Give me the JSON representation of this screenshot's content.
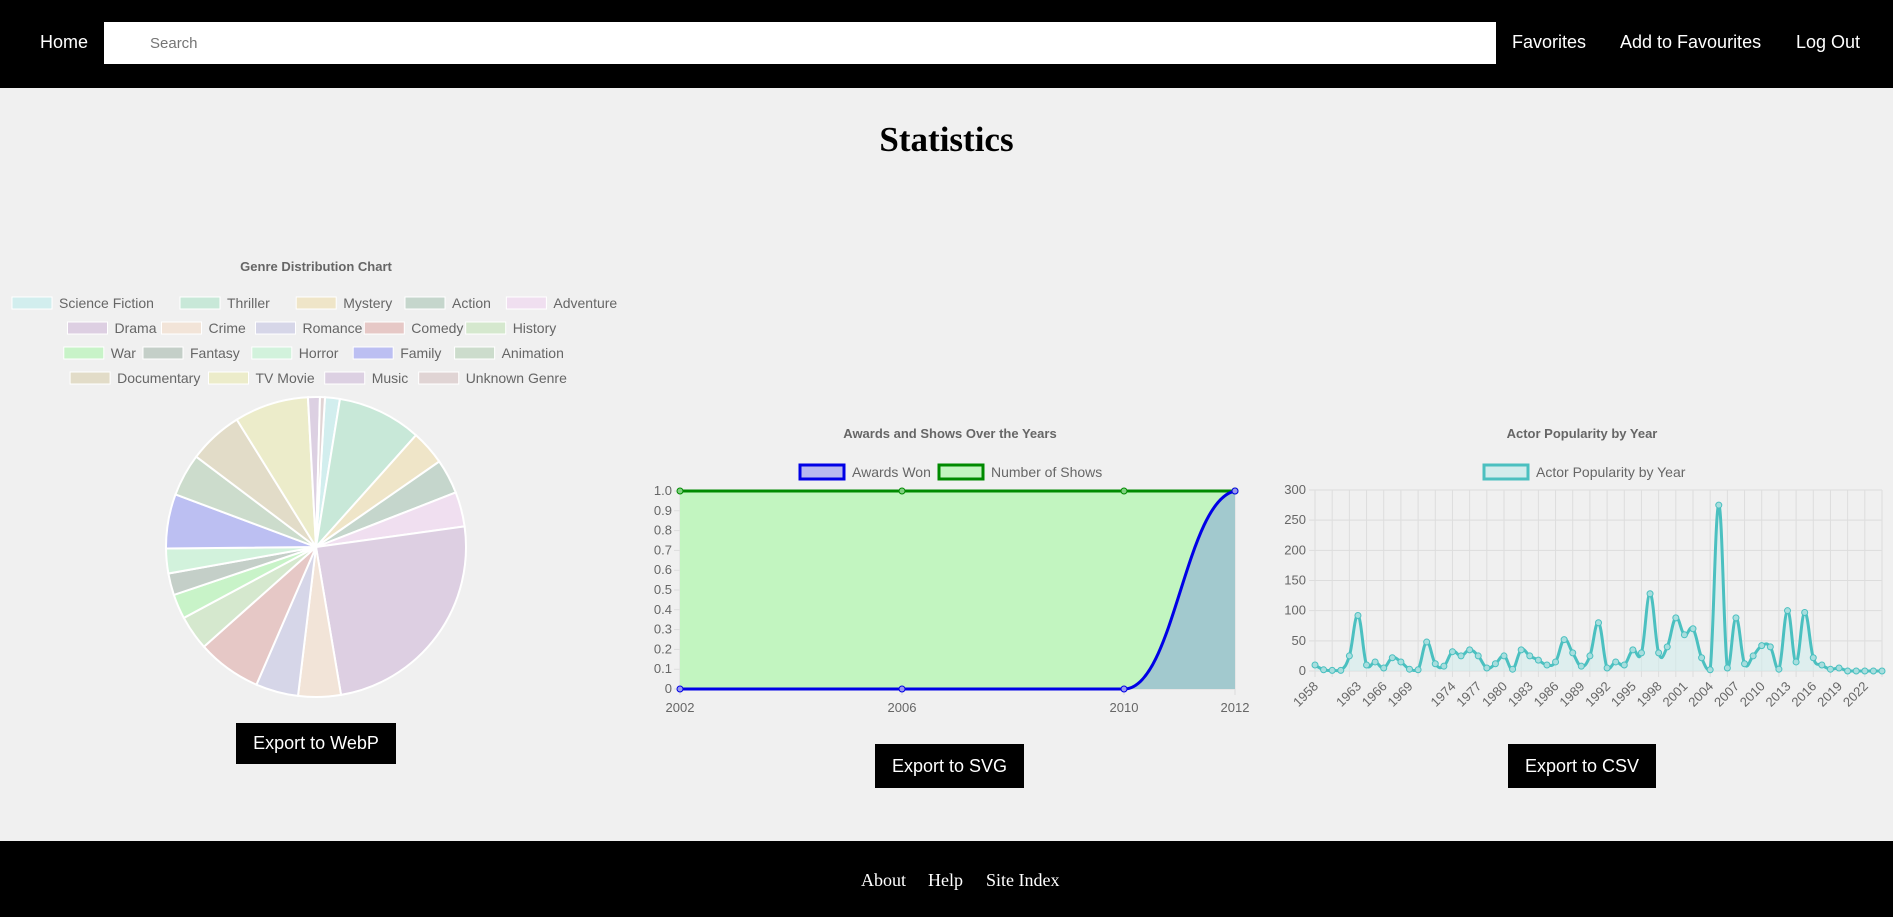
{
  "header": {
    "home_label": "Home",
    "search_placeholder": "Search",
    "search_value": "",
    "nav": [
      "Favorites",
      "Add to Favourites",
      "Log Out"
    ]
  },
  "page_title": "Statistics",
  "buttons": {
    "export_webp": "Export to WebP",
    "export_svg": "Export to SVG",
    "export_csv": "Export to CSV"
  },
  "footer": {
    "links": [
      "About",
      "Help",
      "Site Index"
    ]
  },
  "chart_data": [
    {
      "type": "pie",
      "title": "Genre Distribution Chart",
      "legend_position": "top",
      "categories": [
        "Science Fiction",
        "Thriller",
        "Mystery",
        "Action",
        "Adventure",
        "Drama",
        "Crime",
        "Romance",
        "Comedy",
        "History",
        "War",
        "Fantasy",
        "Horror",
        "Family",
        "Animation",
        "Documentary",
        "TV Movie",
        "Music",
        "Unknown Genre"
      ],
      "values": [
        1.5,
        8.5,
        3.5,
        3.5,
        3.5,
        23,
        4.3,
        4.3,
        6.5,
        3.5,
        2.5,
        2.2,
        2.5,
        5.5,
        4.3,
        5.5,
        7.5,
        1.2,
        0.5
      ],
      "colors": [
        "#d2eeee",
        "#c8e8d8",
        "#efe5c8",
        "#c5d6cc",
        "#f0dff0",
        "#ddcfe2",
        "#f2e4d8",
        "#d6d6e8",
        "#e6c8c6",
        "#d5e8ce",
        "#c8f3c8",
        "#c4cfc8",
        "#d2f2dc",
        "#bcbff2",
        "#ccdccc",
        "#e2dcc8",
        "#ececca",
        "#dcd0e2",
        "#e0d4d4"
      ]
    },
    {
      "type": "line",
      "title": "Awards and Shows Over the Years",
      "legend_position": "top",
      "x": [
        2002,
        2006,
        2010,
        2012
      ],
      "ylim": [
        0,
        1
      ],
      "yticks": [
        "0",
        "0.1",
        "0.2",
        "0.3",
        "0.4",
        "0.5",
        "0.6",
        "0.7",
        "0.8",
        "0.9",
        "1.0"
      ],
      "series": [
        {
          "name": "Awards Won",
          "values": [
            0,
            0,
            0,
            1
          ],
          "color": "#0000e6",
          "fill": "#9ec4cf"
        },
        {
          "name": "Number of Shows",
          "values": [
            1,
            1,
            1,
            1
          ],
          "color": "#008a00",
          "fill": "#c2f5c0"
        }
      ]
    },
    {
      "type": "line",
      "title": "Actor Popularity by Year",
      "legend_position": "top",
      "x": [
        1958,
        1959,
        1960,
        1961,
        1962,
        1963,
        1964,
        1965,
        1966,
        1967,
        1968,
        1969,
        1970,
        1971,
        1972,
        1973,
        1974,
        1975,
        1976,
        1977,
        1978,
        1979,
        1980,
        1981,
        1982,
        1983,
        1984,
        1985,
        1986,
        1987,
        1988,
        1989,
        1990,
        1991,
        1992,
        1993,
        1994,
        1995,
        1996,
        1997,
        1998,
        1999,
        2000,
        2001,
        2002,
        2003,
        2004,
        2005,
        2006,
        2007,
        2008,
        2009,
        2010,
        2011,
        2012,
        2013,
        2014,
        2015,
        2016,
        2017,
        2018,
        2019,
        2020,
        2021,
        2022,
        2023,
        2024
      ],
      "x_tick_labels": [
        "1958",
        "1963",
        "1966",
        "1969",
        "1974",
        "1977",
        "1980",
        "1983",
        "1986",
        "1989",
        "1992",
        "1995",
        "1998",
        "2001",
        "2004",
        "2007",
        "2010",
        "2013",
        "2016",
        "2019",
        "2022"
      ],
      "ylim": [
        0,
        300
      ],
      "yticks": [
        "0",
        "50",
        "100",
        "150",
        "200",
        "250",
        "300"
      ],
      "series": [
        {
          "name": "Actor Popularity by Year",
          "color": "#4bc0c0",
          "fill": "#d2ecec",
          "values": [
            10,
            2,
            1,
            1,
            25,
            92,
            10,
            15,
            5,
            22,
            15,
            3,
            2,
            48,
            12,
            8,
            32,
            25,
            35,
            25,
            5,
            12,
            25,
            3,
            35,
            25,
            18,
            10,
            15,
            52,
            30,
            8,
            25,
            80,
            5,
            15,
            10,
            35,
            30,
            128,
            30,
            40,
            88,
            60,
            70,
            22,
            2,
            275,
            5,
            88,
            12,
            25,
            42,
            40,
            3,
            100,
            15,
            97,
            22,
            10,
            3,
            5,
            0,
            0,
            0,
            0,
            0
          ]
        }
      ]
    }
  ]
}
